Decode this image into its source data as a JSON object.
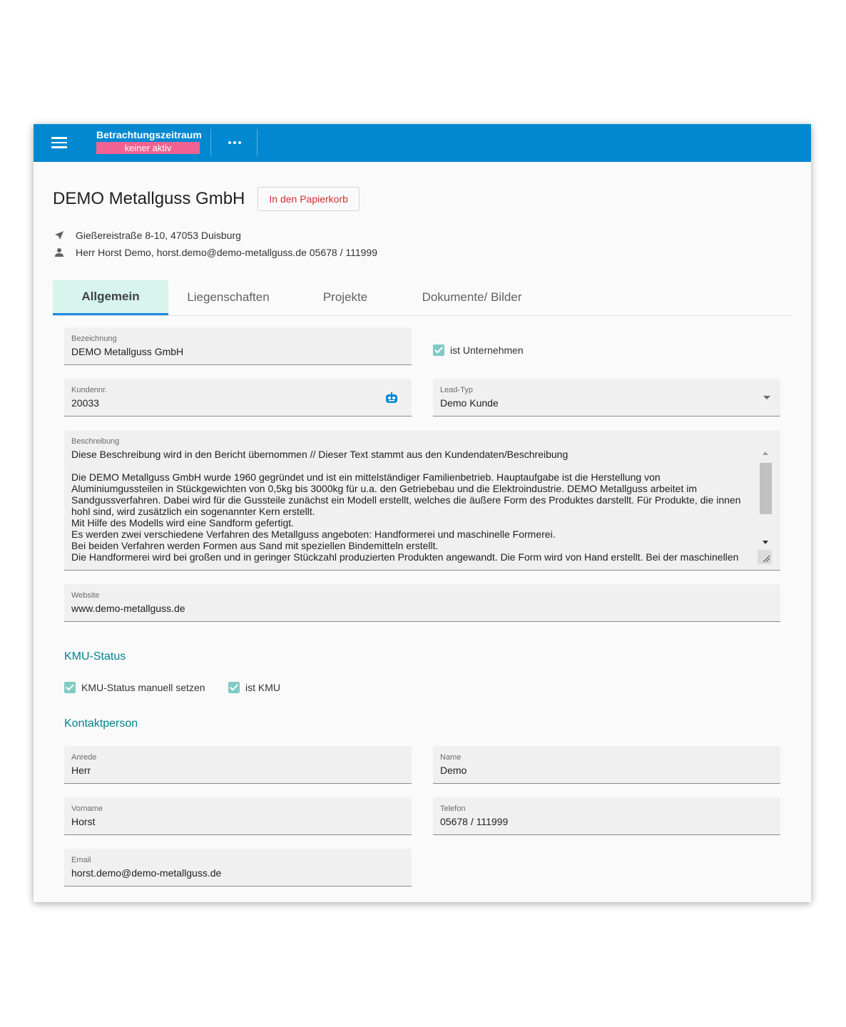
{
  "appbar": {
    "period_title": "Betrachtungszeitraum",
    "period_status": "keiner aktiv",
    "accent_color": "#0288d1",
    "badge_color": "#f06292"
  },
  "company": {
    "title": "DEMO Metallguss GmbH",
    "trash_label": "In den Papierkorb",
    "address": "Gießereistraße 8-10, 47053 Duisburg",
    "contact_line": "Herr Horst Demo, horst.demo@demo-metallguss.de 05678 / 111999"
  },
  "tabs": [
    {
      "label": "Allgemein",
      "active": true
    },
    {
      "label": "Liegenschaften",
      "active": false
    },
    {
      "label": "Projekte",
      "active": false
    },
    {
      "label": "Dokumente/ Bilder",
      "active": false
    }
  ],
  "form": {
    "bezeichnung": {
      "label": "Bezeichnung",
      "value": "DEMO Metallguss GmbH"
    },
    "ist_unternehmen": {
      "label": "ist Unternehmen",
      "checked": true
    },
    "kundennr": {
      "label": "Kundennr.",
      "value": "20033"
    },
    "lead_typ": {
      "label": "Lead-Typ",
      "value": "Demo Kunde"
    },
    "beschreibung": {
      "label": "Beschreibung",
      "value": "Diese Beschreibung wird in den Bericht übernommen // Dieser Text stammt aus den Kundendaten/Beschreibung\n\nDie DEMO Metallguss GmbH wurde 1960 gegründet und ist ein mittelständiger Familienbetrieb. Hauptaufgabe ist die Herstellung von\nAluminiumgussteilen in Stückgewichten von 0,5kg bis 3000kg für u.a. den Getriebebau und die Elektroindustrie. DEMO Metallguss arbeitet im\nSandgussverfahren. Dabei wird für die Gussteile zunächst ein Modell erstellt, welches die äußere Form des Produktes darstellt. Für Produkte, die innen\nhohl sind, wird zusätzlich ein sogenannter Kern erstellt.\nMit Hilfe des Modells wird eine Sandform gefertigt.\nEs werden zwei verschiedene Verfahren des Metallguss angeboten: Handformerei und maschinelle Formerei.\nBei beiden Verfahren werden Formen aus Sand mit speziellen Bindemitteln erstellt.\nDie Handformerei wird bei großen und in geringer Stückzahl produzierten Produkten angewandt. Die Form wird von Hand erstellt. Bei der maschinellen"
    },
    "website": {
      "label": "Website",
      "value": "www.demo-metallguss.de"
    }
  },
  "kmu": {
    "title": "KMU-Status",
    "manual": {
      "label": "KMU-Status manuell setzen",
      "checked": true
    },
    "ist_kmu": {
      "label": "ist KMU",
      "checked": true
    }
  },
  "kontakt": {
    "title": "Kontaktperson",
    "anrede": {
      "label": "Anrede",
      "value": "Herr"
    },
    "name": {
      "label": "Name",
      "value": "Demo"
    },
    "vorname": {
      "label": "Vorname",
      "value": "Horst"
    },
    "telefon": {
      "label": "Telefon",
      "value": "05678 / 111999"
    },
    "email": {
      "label": "Email",
      "value": "horst.demo@demo-metallguss.de"
    }
  }
}
